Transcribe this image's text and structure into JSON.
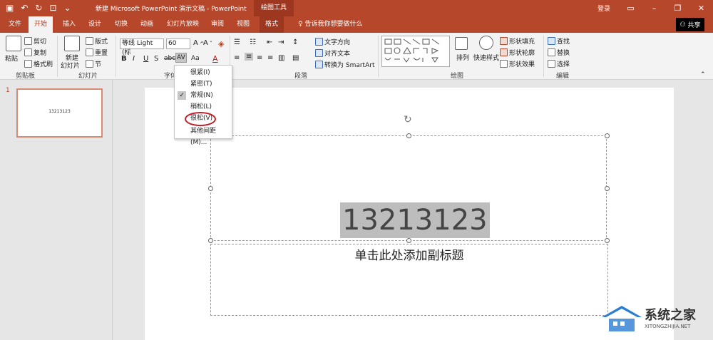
{
  "titlebar": {
    "title": "新建 Microsoft PowerPoint 演示文稿 - PowerPoint",
    "context_group": "绘图工具",
    "signin": "登录"
  },
  "tabs": [
    "文件",
    "开始",
    "插入",
    "设计",
    "切换",
    "动画",
    "幻灯片放映",
    "审阅",
    "视图",
    "格式"
  ],
  "tell_me": "告诉我你想要做什么",
  "share": "共享",
  "ribbon": {
    "clipboard": {
      "paste": "粘贴",
      "cut": "剪切",
      "copy": "复制",
      "format_painter": "格式刷",
      "label": "剪贴板"
    },
    "slides": {
      "new_slide_1": "新建",
      "new_slide_2": "幻灯片",
      "layout": "版式",
      "reset": "重置",
      "section": "节",
      "label": "幻灯片"
    },
    "font": {
      "font_name": "等线 Light (标",
      "font_size": "60",
      "label": "字体"
    },
    "paragraph": {
      "text_direction": "文字方向",
      "align_text": "对齐文本",
      "convert_smartart": "转换为 SmartArt",
      "label": "段落"
    },
    "drawing": {
      "arrange": "排列",
      "quick_styles": "快速样式",
      "shape_fill": "形状填充",
      "shape_outline": "形状轮廓",
      "shape_effects": "形状效果",
      "label": "绘图"
    },
    "editing": {
      "find": "查找",
      "replace": "替换",
      "select": "选择",
      "label": "编辑"
    }
  },
  "spacing_menu": {
    "items": [
      "很紧(I)",
      "紧密(T)",
      "常规(N)",
      "稍松(L)",
      "很松(V)",
      "其他间距(M)..."
    ],
    "checked_index": 2
  },
  "thumbnail": {
    "number": "1",
    "text": "13213123"
  },
  "slide": {
    "title": "13213123",
    "subtitle": "单击此处添加副标题"
  },
  "watermark": {
    "brand": "系统之家",
    "url": "XITONGZHIJIA.NET"
  },
  "colors": {
    "accent": "#b7472a",
    "highlight_circle": "#c0202a"
  }
}
